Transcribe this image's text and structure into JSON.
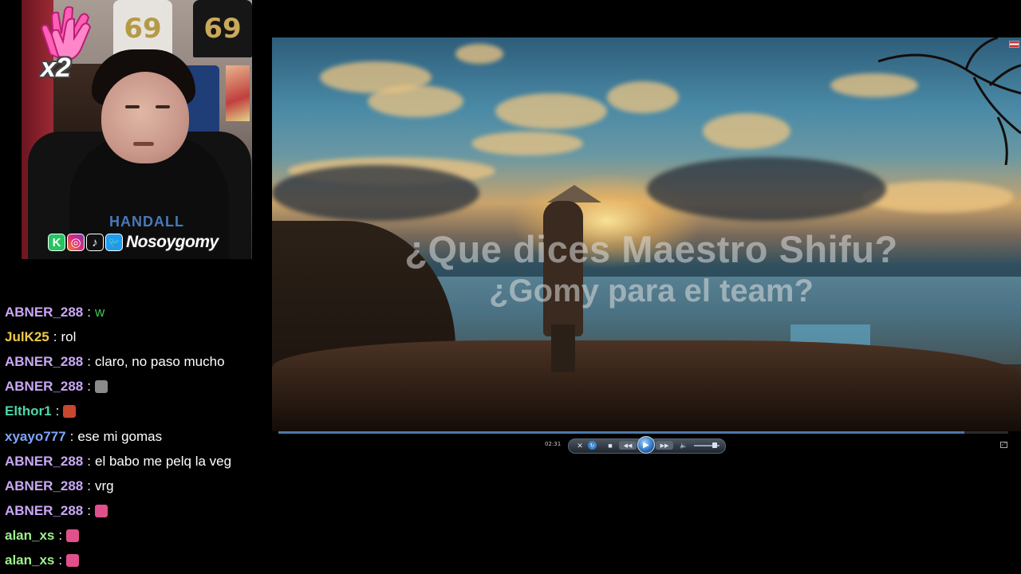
{
  "webcam": {
    "emote_multiplier": "x2",
    "jersey_number": "69",
    "shirt_print": "HANDALL",
    "socials": {
      "icons": [
        "kick-icon",
        "instagram-icon",
        "tiktok-icon",
        "twitter-icon"
      ],
      "icon_labels": [
        "K",
        "◎",
        "♪",
        "🐦"
      ],
      "handle": "Nosoygomy"
    }
  },
  "chat": {
    "messages": [
      {
        "user": "ABNER_288",
        "color": "#c9a7f5",
        "text": "w",
        "text_color": "#3fc75a"
      },
      {
        "user": "JulK25",
        "color": "#f0c94a",
        "text": "rol"
      },
      {
        "user": "ABNER_288",
        "color": "#c9a7f5",
        "text": "claro, no paso mucho"
      },
      {
        "user": "ABNER_288",
        "color": "#c9a7f5",
        "text": "",
        "emote": "#8a8a8a"
      },
      {
        "user": "Elthor1",
        "color": "#4fd6a5",
        "text": "",
        "emote": "#c9472f"
      },
      {
        "user": "xyayo777",
        "color": "#7fa6ff",
        "text": "ese mi gomas"
      },
      {
        "user": "ABNER_288",
        "color": "#c9a7f5",
        "text": "el babo me pelq la veg"
      },
      {
        "user": "ABNER_288",
        "color": "#c9a7f5",
        "text": "vrg"
      },
      {
        "user": "ABNER_288",
        "color": "#c9a7f5",
        "text": "",
        "emote": "#e0508a"
      },
      {
        "user": "alan_xs",
        "color": "#9ff08f",
        "text": "",
        "emote": "#e0508a"
      },
      {
        "user": "alan_xs",
        "color": "#9ff08f",
        "text": "",
        "emote": "#e0508a"
      }
    ],
    "separator": ":"
  },
  "video": {
    "subtitle_line1": "¿Que dices Maestro Shifu?",
    "subtitle_line2": "¿Gomy para el team?",
    "current_time": "02:31",
    "progress": 0.94
  },
  "controls": {
    "play_icon": "▶",
    "rewind_icon": "◀◀",
    "forward_icon": "▶▶",
    "stop_icon": "■",
    "volume_icon": "🔈",
    "volume_level": 0.8
  },
  "colors": {
    "accent": "#4d78a8",
    "background": "#000000"
  }
}
